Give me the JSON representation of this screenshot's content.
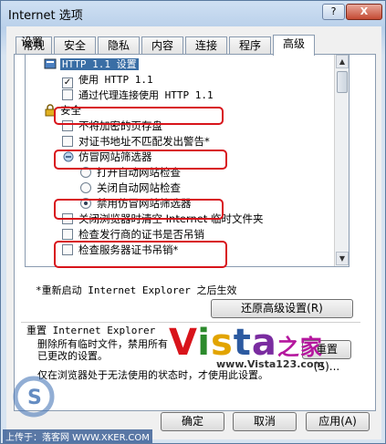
{
  "window": {
    "title": "Internet 选项",
    "help": "?",
    "close": "X"
  },
  "tabs": [
    "常规",
    "安全",
    "隐私",
    "内容",
    "连接",
    "程序",
    "高级"
  ],
  "settings_label": "设置",
  "list": {
    "http_category": "HTTP 1.1 设置",
    "use_http11": "使用 HTTP 1.1",
    "use_http11_proxy": "通过代理连接使用 HTTP 1.1",
    "security_category": "安全",
    "no_save_encrypted": "不将加密的页存盘",
    "warn_cert_mismatch": "对证书地址不匹配发出警告*",
    "phishing_filter": "仿冒网站筛选器",
    "phishing_on": "打开自动网站检查",
    "phishing_off": "关闭自动网站检查",
    "phishing_disable": "禁用仿冒网站筛选器",
    "clear_temp_files": "关闭浏览器时清空 Internet 临时文件夹",
    "check_publisher_revocation": "检查发行商的证书是否吊销",
    "check_server_revocation": "检查服务器证书吊销*"
  },
  "restart_note": "*重新启动 Internet Explorer 之后生效",
  "restore_button": "还原高级设置(R)",
  "reset": {
    "group_title": "重置 Internet Explorer",
    "text": "删除所有临时文件，禁用所有已更改的设置。",
    "button": "重置(S)...",
    "note": "仅在浏览器处于无法使用的状态时，才使用此设置。"
  },
  "footer_buttons": {
    "ok": "确定",
    "cancel": "取消",
    "apply": "应用(A)"
  },
  "watermark": {
    "vista": "Vista",
    "home": "之家",
    "url": "www.Vista123.com",
    "footer": "上传于：落客网 WWW.XKER.COM"
  },
  "colors": {
    "annotation_red": "#d8141b",
    "selection_blue": "#3a6ea5"
  }
}
